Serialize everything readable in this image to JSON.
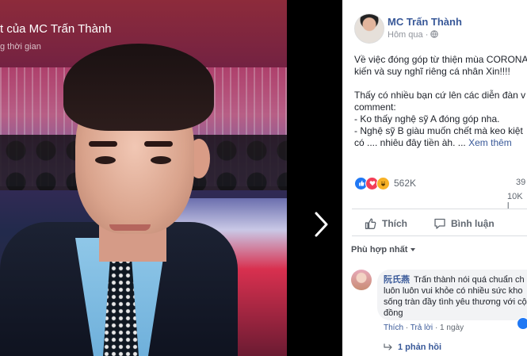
{
  "viewer": {
    "caption": "t của MC Trấn Thành",
    "subcaption": "g thời gian"
  },
  "post": {
    "author": "MC Trấn Thành",
    "time": "Hôm qua",
    "privacy_icon": "globe-icon",
    "text": "Về việc đóng góp từ thiện mùa CORONA\nkiến và suy nghĩ riêng cá nhân Xin!!!!\n\nThấy có nhiều bạn cứ lên các diễn đàn v\ncomment:\n- Ko thấy nghệ sỹ A đóng góp nha.\n- Nghệ sỹ B giàu muốn chết mà keo kiệt\ncó .... nhiêu đây tiền àh. ...",
    "see_more": "Xem thêm"
  },
  "stats": {
    "reactions_icons": [
      "like-icon",
      "love-icon",
      "haha-icon"
    ],
    "reactions_count": "562K",
    "comments_count": "39",
    "shares_count": "10K l"
  },
  "actions": {
    "like_label": "Thích",
    "comment_label": "Bình luận"
  },
  "comments": {
    "sort_label": "Phù hợp nhất",
    "first": {
      "author": "阮氏燕",
      "text": "Trấn thành nói quá chuẩn ch luôn luôn vui khỏe có nhiều sức kho sống tràn đầy tình yêu thương với cộ đồng",
      "like_label": "Thích",
      "reply_label": "Trả lời",
      "time": "1 ngày"
    },
    "replies_label": "1 phản hồi"
  },
  "colors": {
    "link_blue": "#385898",
    "like_blue": "#2078f4",
    "love_red": "#f33e58",
    "haha_yellow": "#f7b125"
  }
}
